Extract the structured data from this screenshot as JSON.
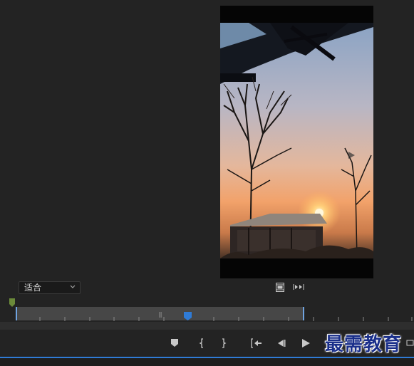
{
  "monitor": {
    "fit_value": "适合",
    "icons": [
      "export-frame-icon",
      "button-editor-icon"
    ]
  },
  "transport": {
    "buttons": [
      "add-marker",
      "mark-in",
      "mark-out",
      "go-to-in",
      "step-back",
      "play",
      "step-forward"
    ]
  },
  "watermark": {
    "text": "最需教育"
  },
  "colors": {
    "accent": "#2f7bd6",
    "panel": "#232323",
    "watermark": "#1a2f8a"
  }
}
